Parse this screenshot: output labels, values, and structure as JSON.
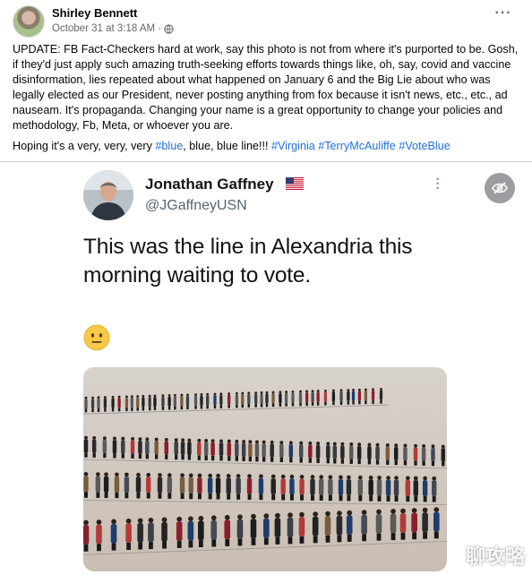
{
  "post": {
    "author": "Shirley Bennett",
    "timestamp": "October 31 at 3:18 AM",
    "separator": "·",
    "audience_icon": "globe-icon",
    "more_label": "···",
    "paragraph1": "UPDATE: FB Fact-Checkers hard at work, say this photo is not from where it's purported to be. Gosh, if they'd just apply such amazing truth-seeking efforts towards things like, oh, say, covid and vaccine disinformation, lies repeated about what happened on January 6 and the Big Lie about who was legally elected as our President, never posting anything from fox because it isn't news, etc., etc., ad nauseam. It's propaganda. Changing your name is a great opportunity to change your policies and methodology, Fb, Meta, or whoever you are.",
    "paragraph2_prefix": "Hoping it's a very, very, very ",
    "hashtag_blue": "#blue",
    "paragraph2_middle": ", blue, blue line!!! ",
    "hashtag_virginia": "#Virginia",
    "hashtag_tmc": "#TerryMcAuliffe",
    "hashtag_voteblue": "#VoteBlue"
  },
  "tweet": {
    "name": "Jonathan Gaffney",
    "handle": "@JGaffneyUSN",
    "flag_icon": "us-flag-icon",
    "text": "This was the line in Alexandria this morning waiting to vote.",
    "emoji": "neutral-face-emoji"
  },
  "media": {
    "reveal_icon": "eye-slash-icon"
  },
  "watermark": "聊攻略",
  "colors": {
    "hashtag": "#216fdb",
    "secondary_text": "#65676b",
    "tweet_handle": "#536471"
  }
}
